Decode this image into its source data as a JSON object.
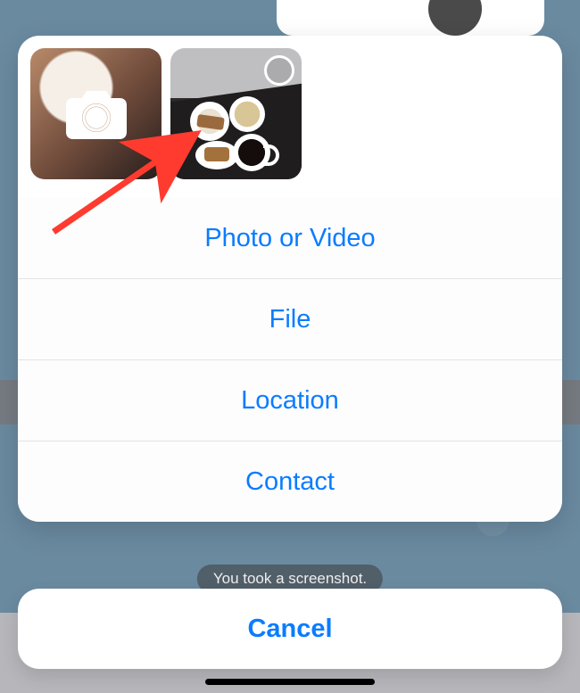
{
  "actionSheet": {
    "thumbnails": {
      "camera": "camera",
      "recentPhotoAlt": "recent-photo"
    },
    "options": [
      {
        "label": "Photo or Video"
      },
      {
        "label": "File"
      },
      {
        "label": "Location"
      },
      {
        "label": "Contact"
      }
    ],
    "cancel": "Cancel"
  },
  "background": {
    "systemMessage": "You took a screenshot."
  },
  "colors": {
    "accent": "#0a7cff",
    "annotationArrow": "#ff3b2f"
  }
}
